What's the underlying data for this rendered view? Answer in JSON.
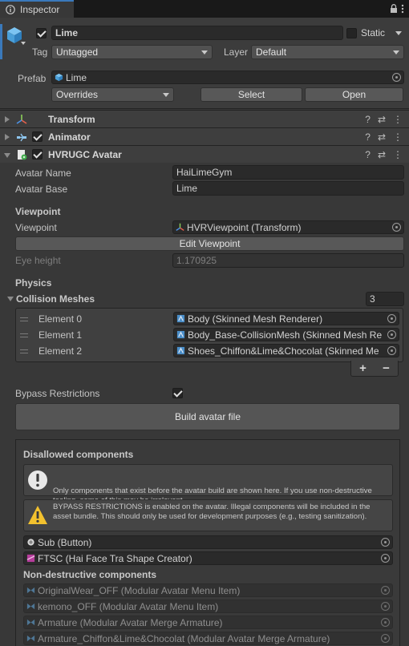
{
  "tab": {
    "title": "Inspector",
    "lock_icon": "lock-icon",
    "menu_icon": "kebab-menu-icon"
  },
  "header": {
    "enabled": true,
    "object_name": "Lime",
    "static_label": "Static",
    "static_checked": false,
    "tag_label": "Tag",
    "tag_value": "Untagged",
    "layer_label": "Layer",
    "layer_value": "Default",
    "prefab_label": "Prefab",
    "prefab_value": "Lime",
    "overrides_label": "Overrides",
    "select_label": "Select",
    "open_label": "Open"
  },
  "components": [
    {
      "name": "Transform",
      "icon": "transform-axes-icon",
      "expanded": false,
      "has_checkbox": false
    },
    {
      "name": "Animator",
      "icon": "animator-icon",
      "expanded": false,
      "has_checkbox": true,
      "enabled": true
    },
    {
      "name": "HVRUGC Avatar",
      "icon": "script-icon",
      "expanded": true,
      "has_checkbox": true,
      "enabled": true
    }
  ],
  "avatar": {
    "avatar_name_label": "Avatar Name",
    "avatar_name_value": "HaiLimeGym",
    "avatar_base_label": "Avatar Base",
    "avatar_base_value": "Lime",
    "viewpoint_section": "Viewpoint",
    "viewpoint_label": "Viewpoint",
    "viewpoint_value": "HVRViewpoint (Transform)",
    "edit_viewpoint_label": "Edit Viewpoint",
    "eye_height_label": "Eye height",
    "eye_height_value": "1.170925",
    "physics_section": "Physics",
    "collision_label": "Collision Meshes",
    "collision_count": "3",
    "elements": [
      {
        "label": "Element 0",
        "value": "Body (Skinned Mesh Renderer)"
      },
      {
        "label": "Element 1",
        "value": "Body_Base-CollisionMesh (Skinned Mesh Re"
      },
      {
        "label": "Element 2",
        "value": "Shoes_Chiffon&Lime&Chocolat (Skinned Me"
      }
    ],
    "add_label": "+",
    "remove_label": "−",
    "bypass_label": "Bypass Restrictions",
    "bypass_checked": true,
    "build_label": "Build avatar file"
  },
  "disallowed": {
    "title": "Disallowed components",
    "info_text": "Only components that exist before the avatar build are shown here. If you use non-destructive tooling, some of this may be irrelevant.\nDisallowed components are removed after non-destructive tooling execute.",
    "warning_text": "BYPASS RESTRICTIONS is enabled on the avatar. Illegal components will be included in the asset bundle. This should only be used for development purposes (e.g., testing sanitization).",
    "items": [
      {
        "value": "Sub (Button)",
        "icon": "button-icon"
      },
      {
        "value": "FTSC (Hai Face Tra Shape Creator)",
        "icon": "script-icon"
      }
    ],
    "nd_title": "Non-destructive components",
    "nd_items": [
      {
        "value": "OriginalWear_OFF (Modular Avatar Menu Item)"
      },
      {
        "value": "kemono_OFF (Modular Avatar Menu Item)"
      },
      {
        "value": "Armature (Modular Avatar Merge Armature)"
      },
      {
        "value": "Armature_Chiffon&Lime&Chocolat (Modular Avatar Merge Armature)"
      }
    ]
  },
  "colors": {
    "accent": "#3a79bb",
    "background": "#383838",
    "field": "#2a2a2a"
  }
}
